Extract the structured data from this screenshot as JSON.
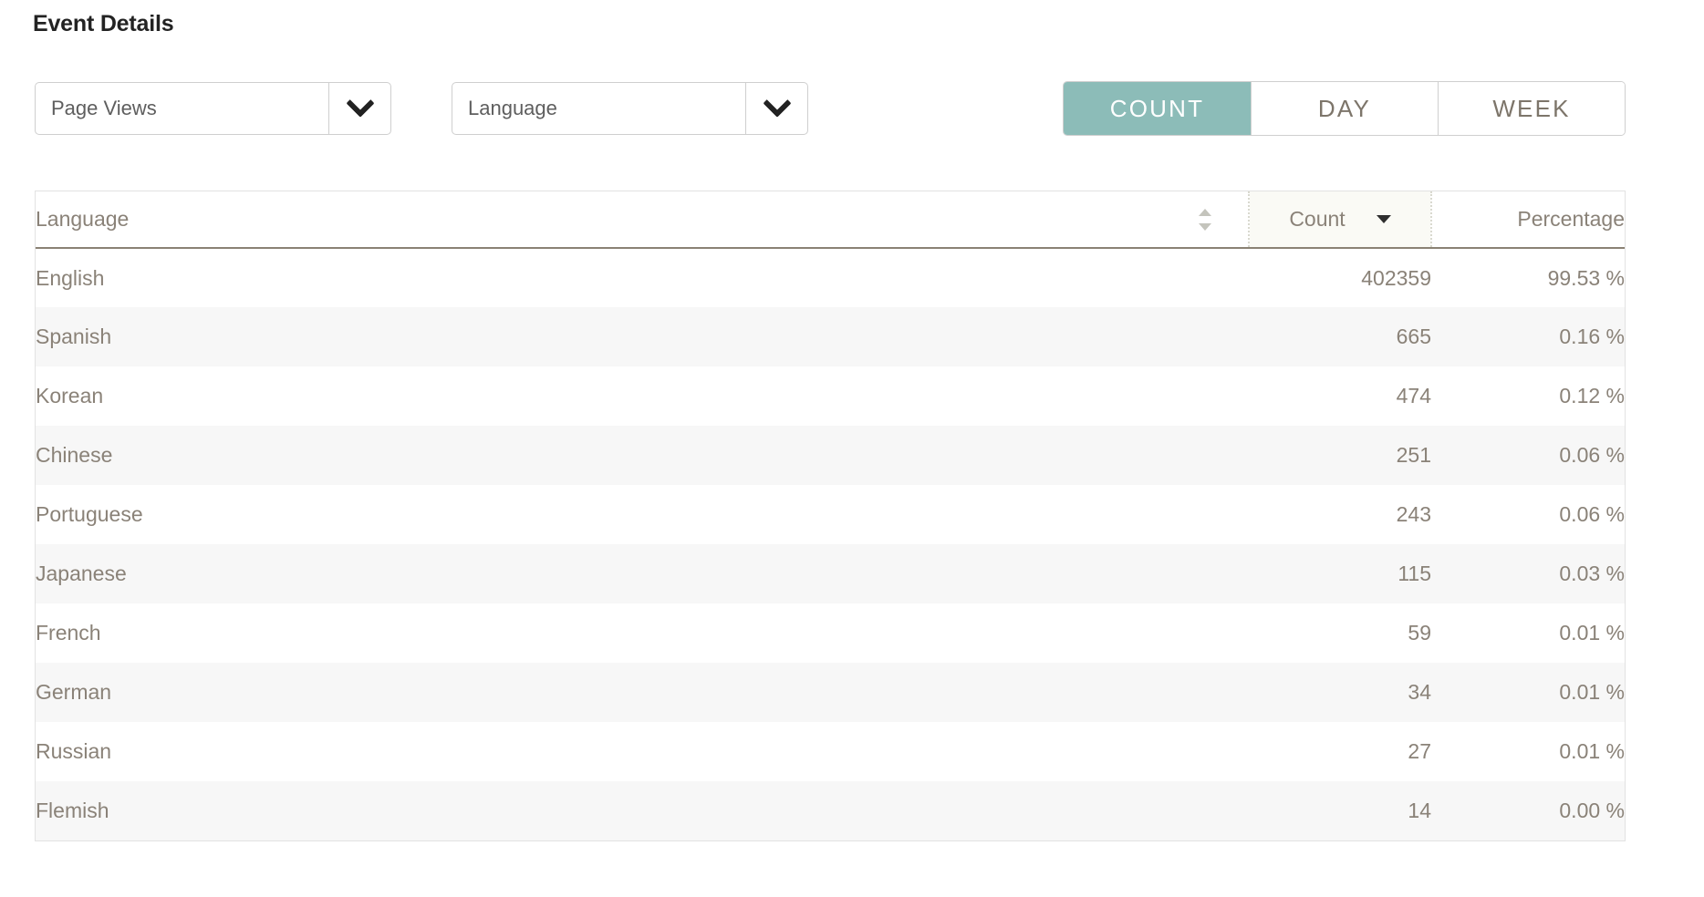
{
  "page": {
    "title": "Event Details"
  },
  "filters": [
    {
      "name": "metric",
      "value": "Page Views",
      "icon": "chevron-down-icon"
    },
    {
      "name": "dimension",
      "value": "Language",
      "icon": "chevron-down-icon"
    }
  ],
  "toggle": {
    "active": "COUNT",
    "active_color": "#8cbcb8",
    "options": [
      {
        "label": "COUNT",
        "active": true
      },
      {
        "label": "DAY",
        "active": false
      },
      {
        "label": "WEEK",
        "active": false
      }
    ]
  },
  "table": {
    "columns": [
      {
        "key": "language",
        "label": "Language",
        "align": "left",
        "sort": "none",
        "sort_icon": "sort-updown-icon"
      },
      {
        "key": "count",
        "label": "Count",
        "align": "right",
        "sort": "descending",
        "sort_icon": "sort-down-icon",
        "highlight_color": "#fafaf5"
      },
      {
        "key": "percentage",
        "label": "Percentage",
        "align": "right",
        "sort": "none",
        "sort_icon": ""
      }
    ],
    "rows": [
      {
        "language": "English",
        "count": "402359",
        "percentage": "99.53 %"
      },
      {
        "language": "Spanish",
        "count": "665",
        "percentage": "0.16 %"
      },
      {
        "language": "Korean",
        "count": "474",
        "percentage": "0.12 %"
      },
      {
        "language": "Chinese",
        "count": "251",
        "percentage": "0.06 %"
      },
      {
        "language": "Portuguese",
        "count": "243",
        "percentage": "0.06 %"
      },
      {
        "language": "Japanese",
        "count": "115",
        "percentage": "0.03 %"
      },
      {
        "language": "French",
        "count": "59",
        "percentage": "0.01 %"
      },
      {
        "language": "German",
        "count": "34",
        "percentage": "0.01 %"
      },
      {
        "language": "Russian",
        "count": "27",
        "percentage": "0.01 %"
      },
      {
        "language": "Flemish",
        "count": "14",
        "percentage": "0.00 %"
      }
    ]
  },
  "chart_data": {
    "type": "table",
    "title": "Event Details",
    "categories": [
      "English",
      "Spanish",
      "Korean",
      "Chinese",
      "Portuguese",
      "Japanese",
      "French",
      "German",
      "Russian",
      "Flemish"
    ],
    "series": [
      {
        "name": "Count",
        "values": [
          402359,
          665,
          474,
          251,
          243,
          115,
          59,
          34,
          27,
          14
        ]
      },
      {
        "name": "Percentage",
        "values": [
          99.53,
          0.16,
          0.12,
          0.06,
          0.06,
          0.03,
          0.01,
          0.01,
          0.01,
          0.0
        ]
      }
    ],
    "xlabel": "Language",
    "ylabel": "Count",
    "sorted_by": "Count",
    "sort_direction": "descending"
  }
}
